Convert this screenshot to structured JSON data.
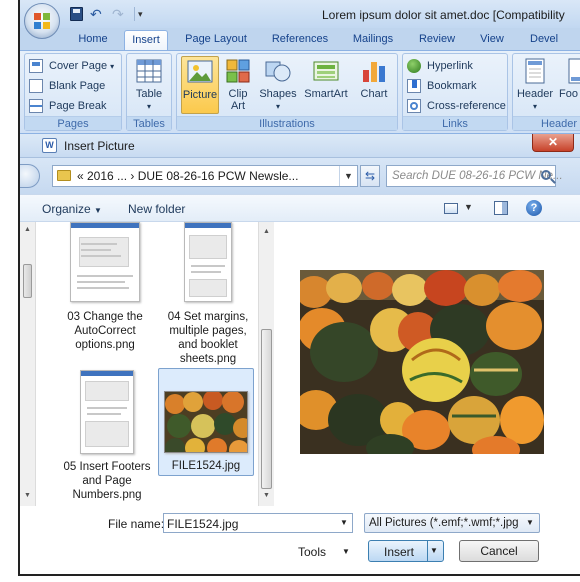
{
  "window": {
    "title": "Lorem ipsum dolor sit amet.doc [Compatibility"
  },
  "ribbon": {
    "tabs": [
      {
        "label": "Home"
      },
      {
        "label": "Insert"
      },
      {
        "label": "Page Layout"
      },
      {
        "label": "References"
      },
      {
        "label": "Mailings"
      },
      {
        "label": "Review"
      },
      {
        "label": "View"
      },
      {
        "label": "Devel"
      }
    ],
    "pages": {
      "label": "Pages",
      "cover_page": "Cover Page",
      "blank_page": "Blank Page",
      "page_break": "Page Break"
    },
    "tables": {
      "label": "Tables",
      "table": "Table"
    },
    "illustrations": {
      "label": "Illustrations",
      "picture": "Picture",
      "clip_art_1": "Clip",
      "clip_art_2": "Art",
      "shapes": "Shapes",
      "smartart": "SmartArt",
      "chart": "Chart"
    },
    "links": {
      "label": "Links",
      "hyperlink": "Hyperlink",
      "bookmark": "Bookmark",
      "cross_reference": "Cross-reference"
    },
    "header_footer": {
      "label": "Header",
      "header": "Header",
      "footer": "Foo"
    }
  },
  "dialog": {
    "title": "Insert Picture",
    "close": "✕",
    "address": "« 2016 ... › DUE 08-26-16 PCW Newsle...",
    "search_placeholder": "Search DUE 08-26-16 PCW Ne...",
    "toolbar": {
      "organize": "Organize",
      "new_folder": "New folder"
    },
    "files": [
      {
        "name_lines": [
          "03 Change the",
          "AutoCorrect",
          "options.png"
        ]
      },
      {
        "name_lines": [
          "04 Set margins,",
          "multiple pages,",
          "and booklet",
          "sheets.png"
        ]
      },
      {
        "name_lines": [
          "05 Insert Footers",
          "and Page",
          "Numbers.png"
        ]
      },
      {
        "name_lines": [
          "FILE1524.jpg"
        ]
      }
    ],
    "file_name_label": "File name:",
    "file_name_value": "FILE1524.jpg",
    "file_type_value": "All Pictures (*.emf;*.wmf;*.jpg;*",
    "tools": "Tools",
    "insert": "Insert",
    "cancel": "Cancel"
  },
  "colors": {
    "ribbon_bg": "#cfe0f5",
    "selected_button": "#fbc94c",
    "selection_bg": "#dcebfc",
    "close_red": "#c7422a"
  },
  "icons": [
    "office-button-icon",
    "save-icon",
    "undo-icon",
    "redo-icon",
    "folder-icon",
    "refresh-icon",
    "search-icon",
    "view-icon",
    "preview-pane-icon",
    "help-icon"
  ]
}
